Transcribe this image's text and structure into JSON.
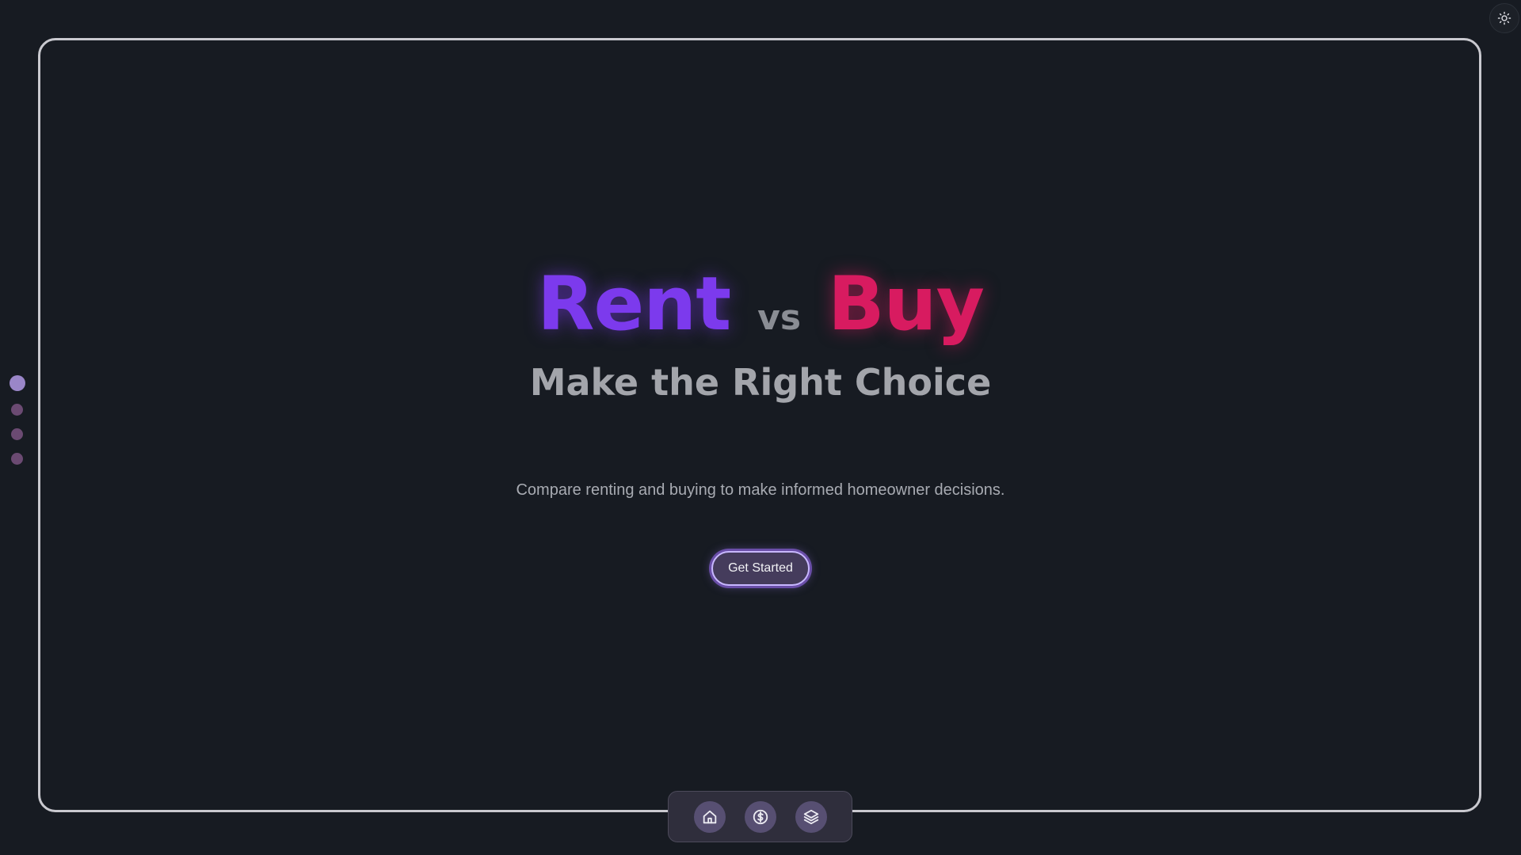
{
  "hero": {
    "title_left": "Rent",
    "title_middle": "vs",
    "title_right": "Buy",
    "subtitle": "Make the Right Choice",
    "description": "Compare renting and buying to make informed homeowner decisions.",
    "cta_label": "Get Started"
  },
  "section_nav": {
    "count": 4,
    "active_index": 0
  },
  "dock": {
    "items": [
      {
        "icon": "home-icon"
      },
      {
        "icon": "dollar-icon"
      },
      {
        "icon": "layers-icon"
      }
    ]
  },
  "theme_toggle": {
    "icon": "sun-icon"
  },
  "colors": {
    "background": "#171b22",
    "rent": "#7c3aed",
    "buy": "#d81b60",
    "frame_border": "#c9c9cf",
    "button_bg": "#453c5c",
    "button_border": "#c8b8ff"
  }
}
